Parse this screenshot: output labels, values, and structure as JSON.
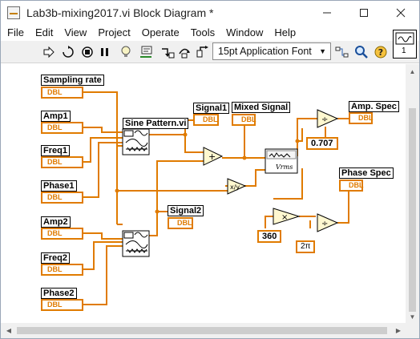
{
  "window": {
    "title": "Lab3b-mixing2017.vi Block Diagram *",
    "minimize_icon": "minimize-icon",
    "maximize_icon": "maximize-icon",
    "close_icon": "close-icon"
  },
  "menubar": {
    "items": [
      "File",
      "Edit",
      "View",
      "Project",
      "Operate",
      "Tools",
      "Window",
      "Help"
    ]
  },
  "toolbar": {
    "font_select": "15pt Application Font",
    "connector_number": "1",
    "icons": [
      "run-arrow-icon",
      "run-continuously-icon",
      "abort-icon",
      "pause-icon",
      "highlight-execution-bulb-icon",
      "retain-wire-values-icon",
      "step-into-icon",
      "step-over-icon",
      "step-out-icon",
      "clean-up-diagram-icon",
      "search-icon",
      "help-icon"
    ]
  },
  "diagram": {
    "controls": [
      {
        "label": "Sampling rate",
        "type": "DBL"
      },
      {
        "label": "Amp1",
        "type": "DBL"
      },
      {
        "label": "Freq1",
        "type": "DBL"
      },
      {
        "label": "Phase1",
        "type": "DBL"
      },
      {
        "label": "Amp2",
        "type": "DBL"
      },
      {
        "label": "Freq2",
        "type": "DBL"
      },
      {
        "label": "Phase2",
        "type": "DBL"
      }
    ],
    "indicators": [
      {
        "label": "Signal1",
        "type": "DBL"
      },
      {
        "label": "Mixed Signal",
        "type": "DBL"
      },
      {
        "label": "Amp. Spec",
        "type": "DBL"
      },
      {
        "label": "Signal2",
        "type": "DBL"
      },
      {
        "label": "Phase Spec",
        "type": "DBL"
      }
    ],
    "subvi_label": "Sine Pattern.vi",
    "spectrum_label": "Vrms",
    "constants": {
      "sqrt_half": "0.707",
      "deg": "360",
      "two_pi": "2π"
    },
    "wire_color": "#e07b00",
    "wire_color_int": "#e07b00"
  }
}
